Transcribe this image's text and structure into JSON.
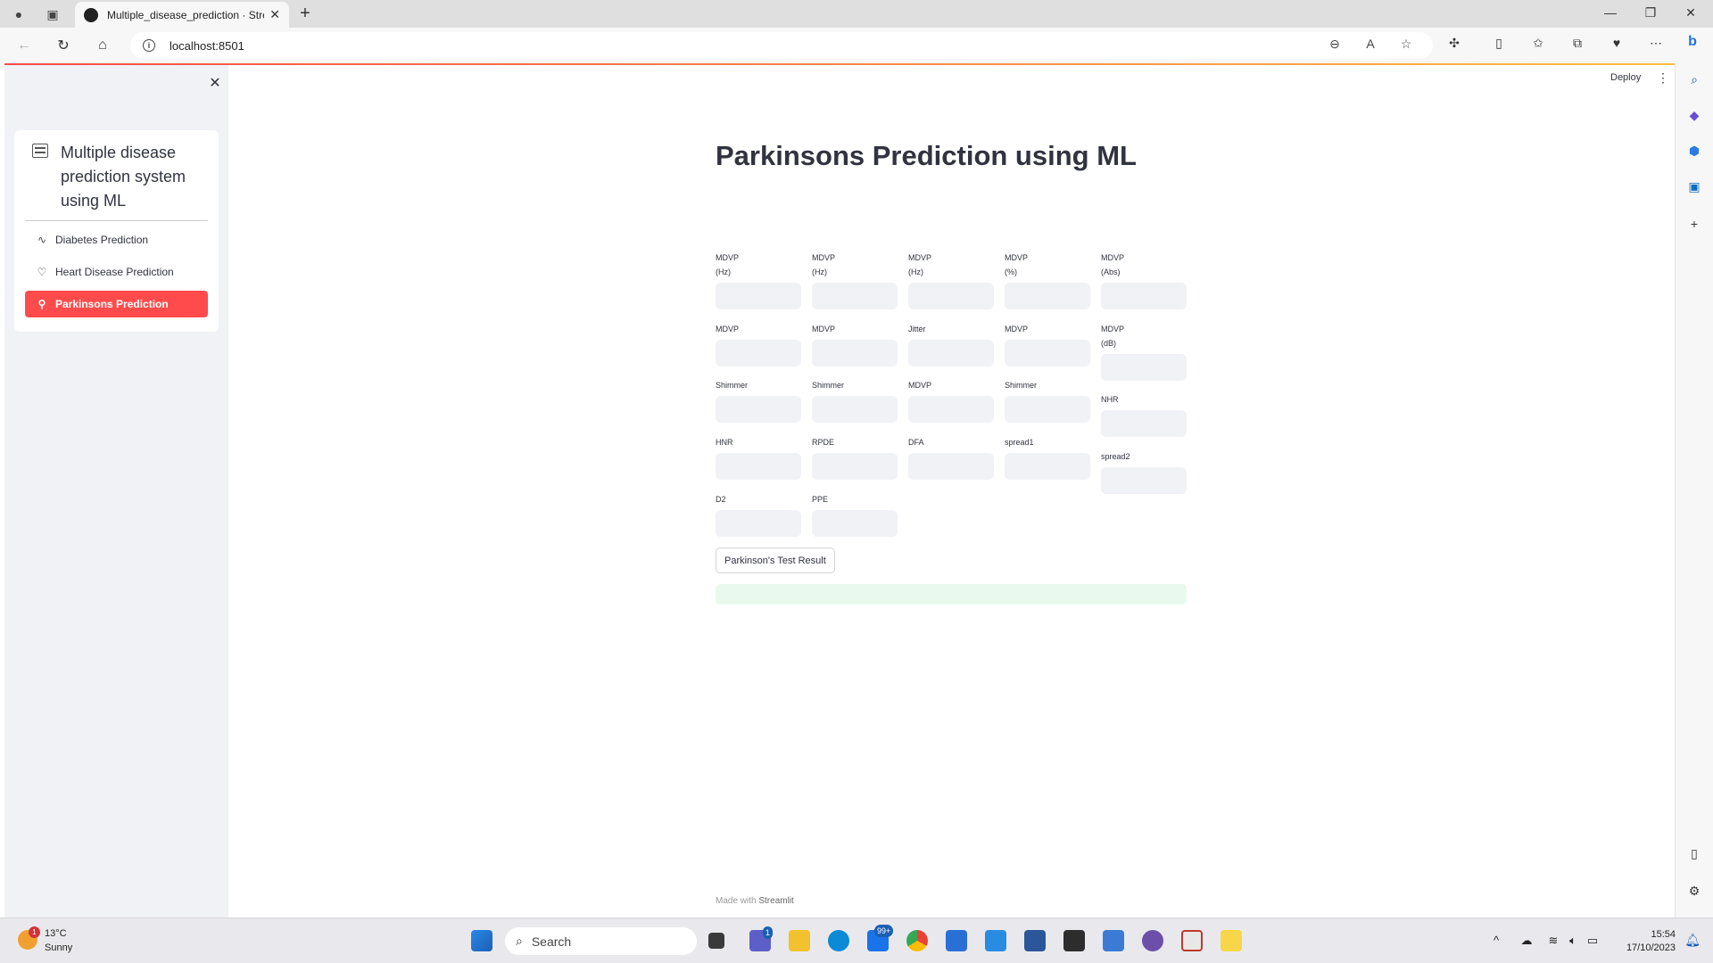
{
  "browser": {
    "tab_title": "Multiple_disease_prediction · Streamlit",
    "url": "localhost:8501"
  },
  "app": {
    "deploy_label": "Deploy",
    "footer_prefix": "Made with",
    "footer_brand": "Streamlit"
  },
  "sidebar": {
    "menu_title": "Multiple disease prediction system using ML",
    "items": [
      {
        "label": "Diabetes Prediction",
        "icon": "activity-icon",
        "active": false
      },
      {
        "label": "Heart Disease Prediction",
        "icon": "heart-icon",
        "active": false
      },
      {
        "label": "Parkinsons Prediction",
        "icon": "person-icon",
        "active": true
      }
    ],
    "accent_color": "#ff4b4b"
  },
  "main": {
    "title": "Parkinsons Prediction using ML",
    "fields": [
      {
        "label_lines": [
          "MDVP",
          "(Hz)"
        ],
        "value": ""
      },
      {
        "label_lines": [
          "MDVP",
          "(Hz)"
        ],
        "value": ""
      },
      {
        "label_lines": [
          "MDVP",
          "(Hz)"
        ],
        "value": ""
      },
      {
        "label_lines": [
          "MDVP",
          "(%)"
        ],
        "value": ""
      },
      {
        "label_lines": [
          "MDVP",
          "(Abs)"
        ],
        "value": ""
      },
      {
        "label_lines": [
          "MDVP"
        ],
        "value": ""
      },
      {
        "label_lines": [
          "MDVP"
        ],
        "value": ""
      },
      {
        "label_lines": [
          "Jitter"
        ],
        "value": ""
      },
      {
        "label_lines": [
          "MDVP"
        ],
        "value": ""
      },
      {
        "label_lines": [
          "MDVP",
          "(dB)"
        ],
        "value": ""
      },
      {
        "label_lines": [
          "Shimmer"
        ],
        "value": ""
      },
      {
        "label_lines": [
          "Shimmer"
        ],
        "value": ""
      },
      {
        "label_lines": [
          "MDVP"
        ],
        "value": ""
      },
      {
        "label_lines": [
          "Shimmer"
        ],
        "value": ""
      },
      {
        "label_lines": [
          "NHR"
        ],
        "value": ""
      },
      {
        "label_lines": [
          "HNR"
        ],
        "value": ""
      },
      {
        "label_lines": [
          "RPDE"
        ],
        "value": ""
      },
      {
        "label_lines": [
          "DFA"
        ],
        "value": ""
      },
      {
        "label_lines": [
          "spread1"
        ],
        "value": ""
      },
      {
        "label_lines": [
          "spread2"
        ],
        "value": ""
      },
      {
        "label_lines": [
          "D2"
        ],
        "value": ""
      },
      {
        "label_lines": [
          "PPE"
        ],
        "value": ""
      }
    ],
    "result_button": "Parkinson's Test Result",
    "result_text": "",
    "result_color": "#e9f9ee"
  },
  "taskbar": {
    "weather_temp": "13°C",
    "weather_desc": "Sunny",
    "weather_badge": "1",
    "search_placeholder": "Search",
    "teams_badge": "1",
    "mail_badge": "99+",
    "time": "15:54",
    "date": "17/10/2023"
  }
}
